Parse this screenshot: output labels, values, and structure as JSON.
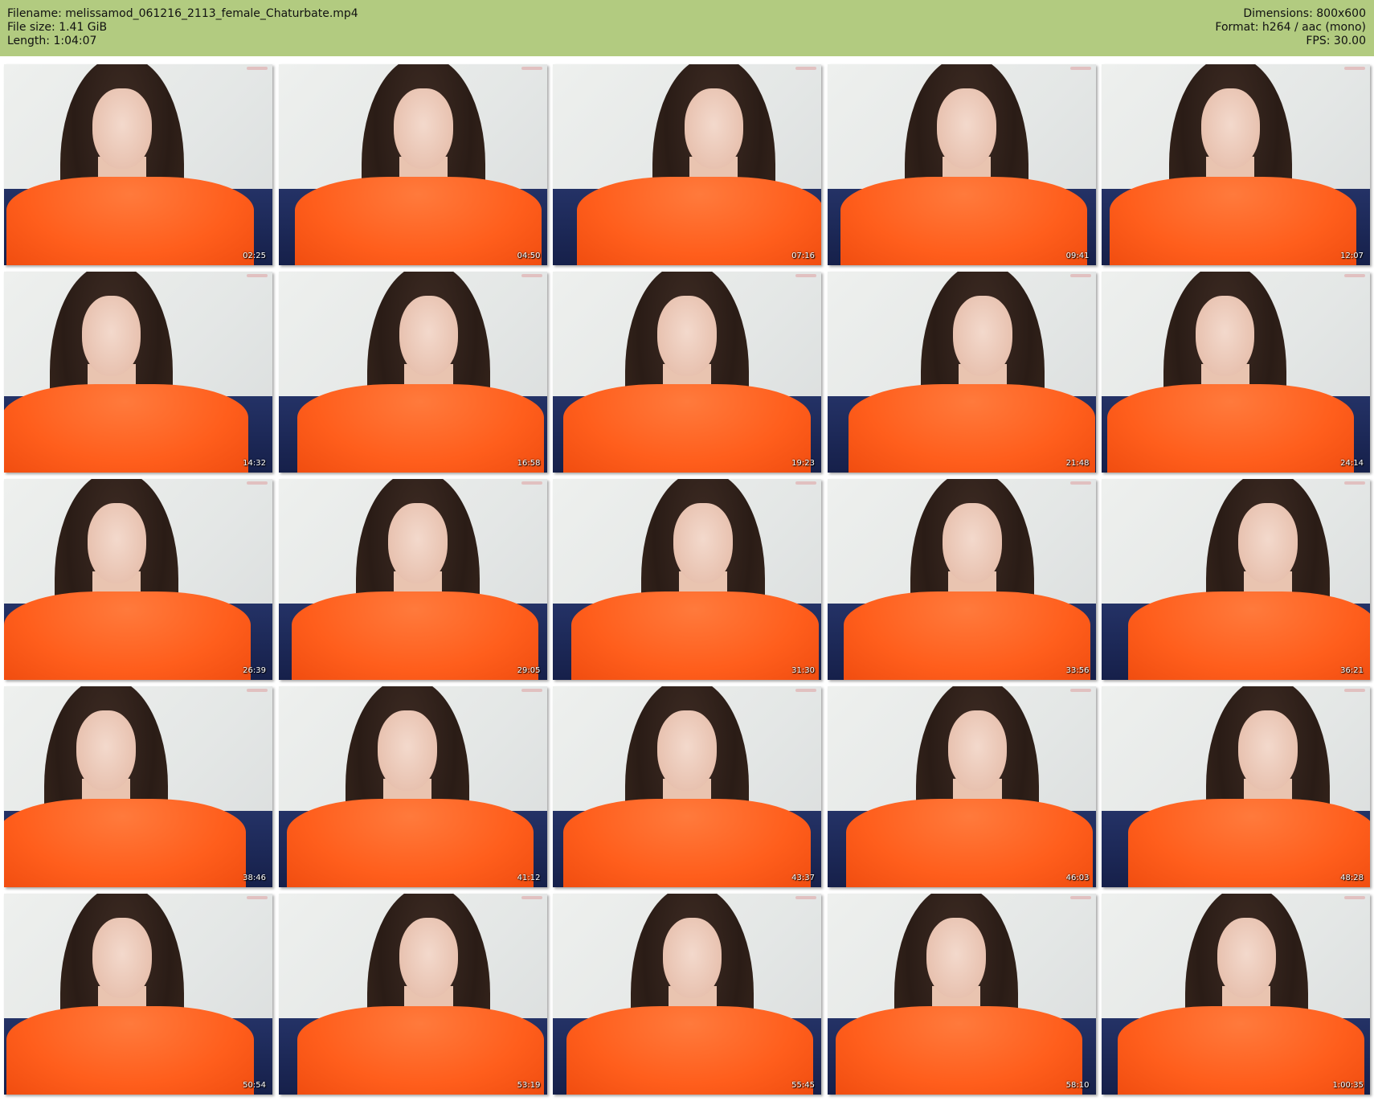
{
  "header": {
    "filename": "Filename: melissamod_061216_2113_female_Chaturbate.mp4",
    "filesize": "File size: 1.41 GiB",
    "length": "Length: 1:04:07",
    "dimensions": "Dimensions: 800x600",
    "format": "Format: h264 / aac (mono)",
    "fps": "FPS: 30.00"
  },
  "colors": {
    "header_bg": "#b2cb80",
    "shirt": "#ff5e1c",
    "sofa": "#1a2452",
    "wall": "#e6e9e8"
  },
  "thumbnails": [
    {
      "timestamp": "02:25"
    },
    {
      "timestamp": "04:50"
    },
    {
      "timestamp": "07:16"
    },
    {
      "timestamp": "09:41"
    },
    {
      "timestamp": "12:07"
    },
    {
      "timestamp": "14:32"
    },
    {
      "timestamp": "16:58"
    },
    {
      "timestamp": "19:23"
    },
    {
      "timestamp": "21:48"
    },
    {
      "timestamp": "24:14"
    },
    {
      "timestamp": "26:39"
    },
    {
      "timestamp": "29:05"
    },
    {
      "timestamp": "31:30"
    },
    {
      "timestamp": "33:56"
    },
    {
      "timestamp": "36:21"
    },
    {
      "timestamp": "38:46"
    },
    {
      "timestamp": "41:12"
    },
    {
      "timestamp": "43:37"
    },
    {
      "timestamp": "46:03"
    },
    {
      "timestamp": "48:28"
    },
    {
      "timestamp": "50:54"
    },
    {
      "timestamp": "53:19"
    },
    {
      "timestamp": "55:45"
    },
    {
      "timestamp": "58:10"
    },
    {
      "timestamp": "1:00:35"
    }
  ]
}
